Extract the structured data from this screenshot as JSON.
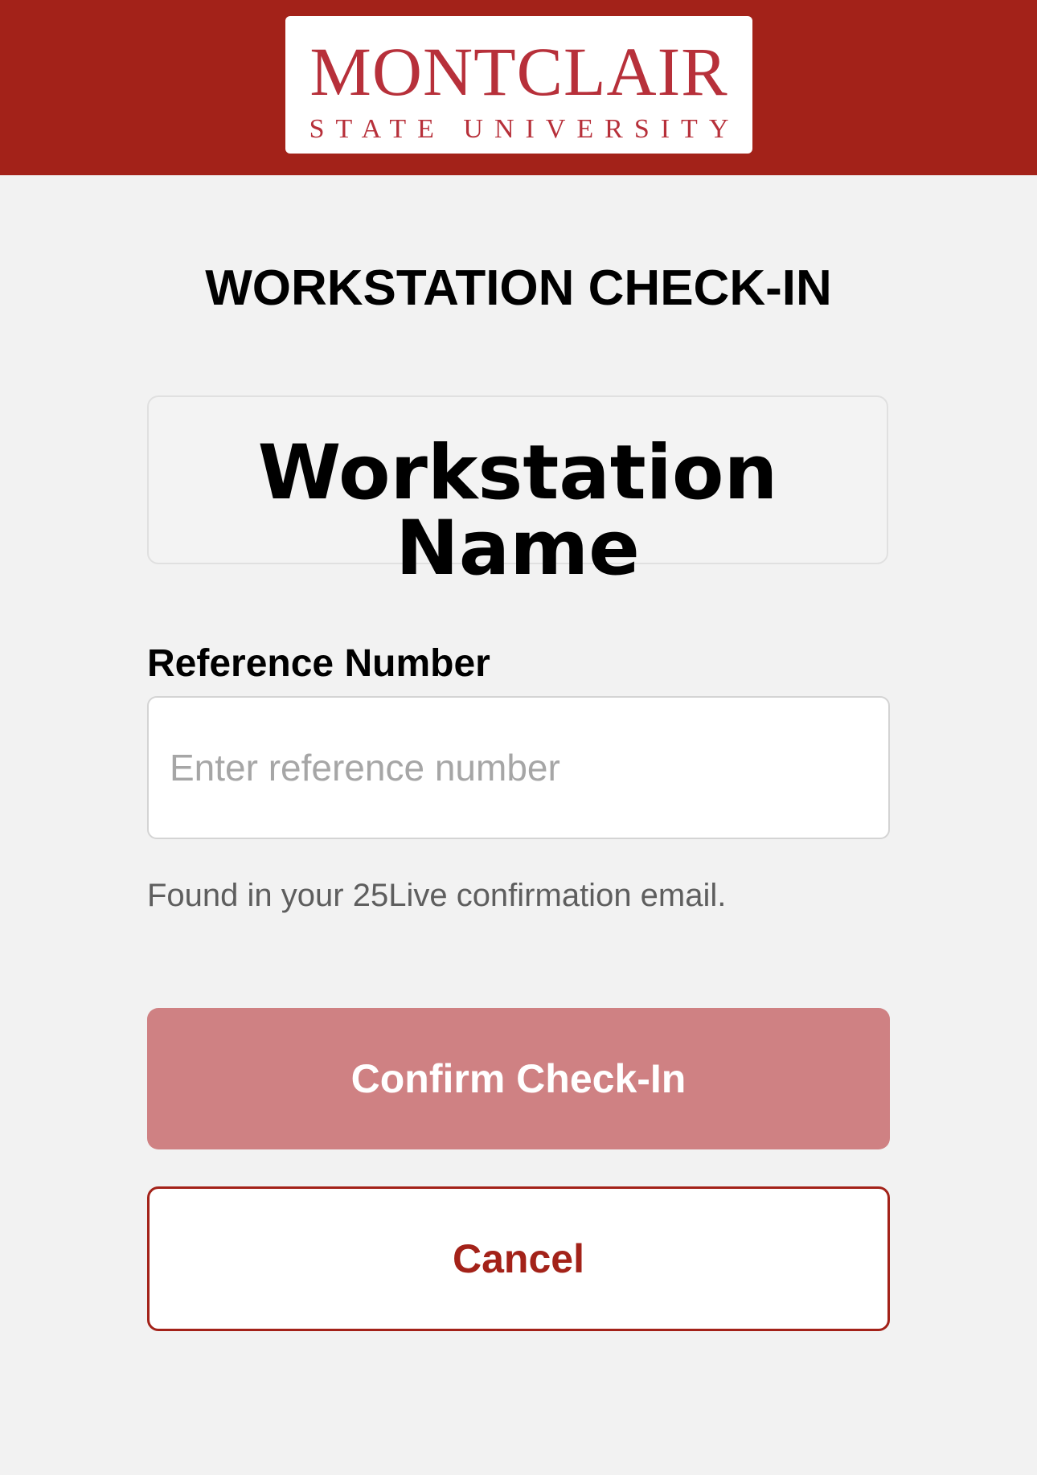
{
  "header": {
    "logo": {
      "main": "MONTCLAIR",
      "sub": "STATE UNIVERSITY"
    },
    "color": "#a32219"
  },
  "page": {
    "title": "WORKSTATION CHECK-IN"
  },
  "workstation": {
    "name": "Workstation Name"
  },
  "form": {
    "reference_label": "Reference Number",
    "reference_value": "",
    "reference_placeholder": "Enter reference number",
    "helper_text": "Found in your 25Live confirmation email."
  },
  "actions": {
    "confirm_label": "Confirm Check-In",
    "confirm_state": "disabled",
    "confirm_color": "#cf8183",
    "cancel_label": "Cancel",
    "cancel_color": "#a32219"
  }
}
